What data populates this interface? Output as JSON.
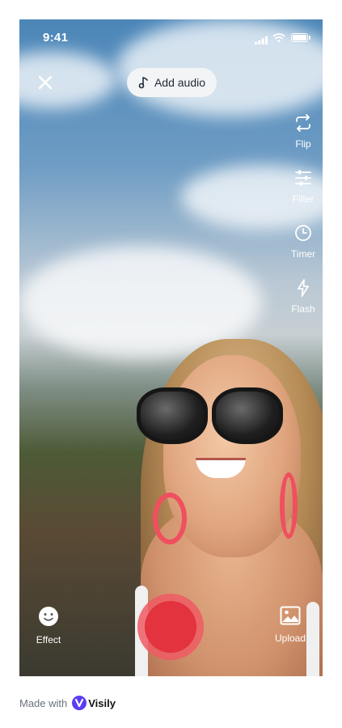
{
  "status_bar": {
    "time": "9:41"
  },
  "top_bar": {
    "add_audio_label": "Add audio"
  },
  "side_tools": [
    {
      "label": "Flip",
      "icon": "flip-icon"
    },
    {
      "label": "Filter",
      "icon": "sliders-icon"
    },
    {
      "label": "Timer",
      "icon": "clock-icon"
    },
    {
      "label": "Flash",
      "icon": "flash-icon"
    }
  ],
  "bottom_bar": {
    "effect_label": "Effect",
    "upload_label": "Upload"
  },
  "footer": {
    "made_with": "Made with",
    "brand": "Visily"
  },
  "colors": {
    "record": "#e2333f",
    "record_ring": "#ee5a64",
    "pill_bg": "#f3f4f6",
    "brand": "#5b3df5"
  }
}
